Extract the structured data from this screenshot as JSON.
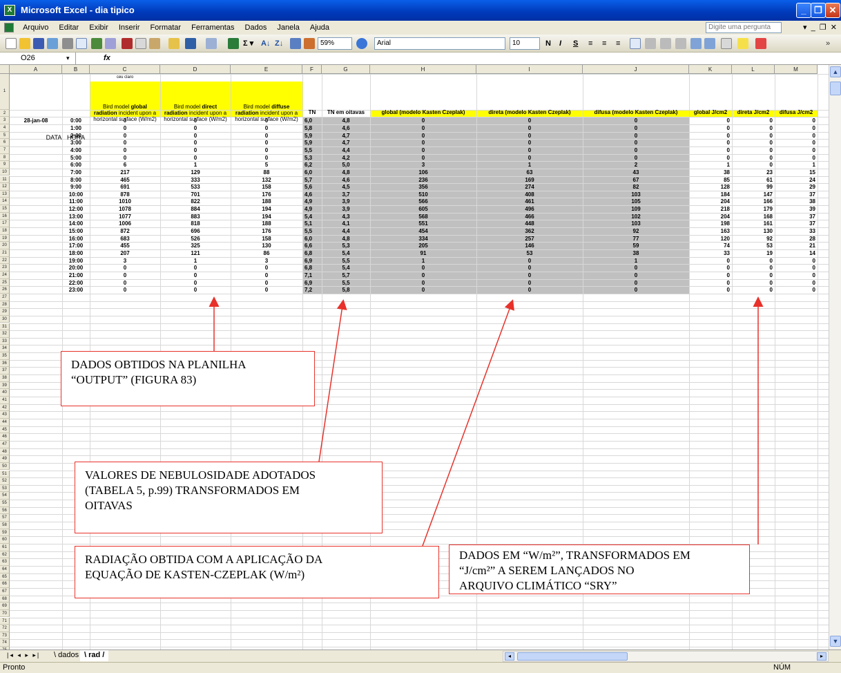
{
  "window": {
    "title": "Microsoft Excel - dia tipico",
    "app_icon": "excel-icon"
  },
  "menu": {
    "items": [
      "Arquivo",
      "Editar",
      "Exibir",
      "Inserir",
      "Formatar",
      "Ferramentas",
      "Dados",
      "Janela",
      "Ajuda"
    ],
    "ask_placeholder": "Digite uma pergunta"
  },
  "toolbar": {
    "zoom": "59%",
    "font": "Arial",
    "size": "10",
    "bold": "N",
    "italic": "I",
    "underline": "S"
  },
  "formula": {
    "cell_ref": "O26",
    "fx": "fx",
    "content": ""
  },
  "columns": [
    "A",
    "B",
    "C",
    "D",
    "E",
    "F",
    "G",
    "H",
    "I",
    "J",
    "K",
    "L",
    "M"
  ],
  "sheet": {
    "note_row1": "ceu claro",
    "headers": {
      "A": "DATA",
      "B": "HORA",
      "C": {
        "pre": "Bird model ",
        "bold": "global radiation",
        "post": " incident upon a horizontal surface (W/m2)"
      },
      "D": {
        "pre": "Bird model ",
        "bold": "direct radiation",
        "post": " incident upon a horizontal surface (W/m2)"
      },
      "E": {
        "pre": "Bird model ",
        "bold": "diffuse radiation",
        "post": " incident upon a horizontal surface (W/m2)"
      },
      "F": "TN",
      "G": "TN em oitavas",
      "H": "global (modelo Kasten Czeplak)",
      "I": "direta (modelo Kasten Czeplak)",
      "J": "difusa (modelo Kasten Czeplak)",
      "K": "global J/cm2",
      "L": "direta J/cm2",
      "M": "difusa J/cm2"
    },
    "date": "28-jan-08",
    "rows": [
      [
        "0:00",
        "0",
        "0",
        "0",
        "6,0",
        "4,8",
        "0",
        "0",
        "0",
        "0",
        "0",
        "0"
      ],
      [
        "1:00",
        "0",
        "0",
        "0",
        "5,8",
        "4,6",
        "0",
        "0",
        "0",
        "0",
        "0",
        "0"
      ],
      [
        "2:00",
        "0",
        "0",
        "0",
        "5,9",
        "4,7",
        "0",
        "0",
        "0",
        "0",
        "0",
        "0"
      ],
      [
        "3:00",
        "0",
        "0",
        "0",
        "5,9",
        "4,7",
        "0",
        "0",
        "0",
        "0",
        "0",
        "0"
      ],
      [
        "4:00",
        "0",
        "0",
        "0",
        "5,5",
        "4,4",
        "0",
        "0",
        "0",
        "0",
        "0",
        "0"
      ],
      [
        "5:00",
        "0",
        "0",
        "0",
        "5,3",
        "4,2",
        "0",
        "0",
        "0",
        "0",
        "0",
        "0"
      ],
      [
        "6:00",
        "6",
        "1",
        "5",
        "6,2",
        "5,0",
        "3",
        "1",
        "2",
        "1",
        "0",
        "1"
      ],
      [
        "7:00",
        "217",
        "129",
        "88",
        "6,0",
        "4,8",
        "106",
        "63",
        "43",
        "38",
        "23",
        "15"
      ],
      [
        "8:00",
        "465",
        "333",
        "132",
        "5,7",
        "4,6",
        "236",
        "169",
        "67",
        "85",
        "61",
        "24"
      ],
      [
        "9:00",
        "691",
        "533",
        "158",
        "5,6",
        "4,5",
        "356",
        "274",
        "82",
        "128",
        "99",
        "29"
      ],
      [
        "10:00",
        "878",
        "701",
        "176",
        "4,6",
        "3,7",
        "510",
        "408",
        "103",
        "184",
        "147",
        "37"
      ],
      [
        "11:00",
        "1010",
        "822",
        "188",
        "4,9",
        "3,9",
        "566",
        "461",
        "105",
        "204",
        "166",
        "38"
      ],
      [
        "12:00",
        "1078",
        "884",
        "194",
        "4,9",
        "3,9",
        "605",
        "496",
        "109",
        "218",
        "179",
        "39"
      ],
      [
        "13:00",
        "1077",
        "883",
        "194",
        "5,4",
        "4,3",
        "568",
        "466",
        "102",
        "204",
        "168",
        "37"
      ],
      [
        "14:00",
        "1006",
        "818",
        "188",
        "5,1",
        "4,1",
        "551",
        "448",
        "103",
        "198",
        "161",
        "37"
      ],
      [
        "15:00",
        "872",
        "696",
        "176",
        "5,5",
        "4,4",
        "454",
        "362",
        "92",
        "163",
        "130",
        "33"
      ],
      [
        "16:00",
        "683",
        "526",
        "158",
        "6,0",
        "4,8",
        "334",
        "257",
        "77",
        "120",
        "92",
        "28"
      ],
      [
        "17:00",
        "455",
        "325",
        "130",
        "6,6",
        "5,3",
        "205",
        "146",
        "59",
        "74",
        "53",
        "21"
      ],
      [
        "18:00",
        "207",
        "121",
        "86",
        "6,8",
        "5,4",
        "91",
        "53",
        "38",
        "33",
        "19",
        "14"
      ],
      [
        "19:00",
        "3",
        "1",
        "3",
        "6,9",
        "5,5",
        "1",
        "0",
        "1",
        "0",
        "0",
        "0"
      ],
      [
        "20:00",
        "0",
        "0",
        "0",
        "6,8",
        "5,4",
        "0",
        "0",
        "0",
        "0",
        "0",
        "0"
      ],
      [
        "21:00",
        "0",
        "0",
        "0",
        "7,1",
        "5,7",
        "0",
        "0",
        "0",
        "0",
        "0",
        "0"
      ],
      [
        "22:00",
        "0",
        "0",
        "0",
        "6,9",
        "5,5",
        "0",
        "0",
        "0",
        "0",
        "0",
        "0"
      ],
      [
        "23:00",
        "0",
        "0",
        "0",
        "7,2",
        "5,8",
        "0",
        "0",
        "0",
        "0",
        "0",
        "0"
      ]
    ]
  },
  "callouts": {
    "c1": [
      "DADOS OBTIDOS NA PLANILHA",
      "“OUTPUT” (FIGURA 83)"
    ],
    "c2": [
      "VALORES DE NEBULOSIDADE ADOTADOS",
      "(TABELA 5, p.99) TRANSFORMADOS EM",
      "OITAVAS"
    ],
    "c3": [
      "RADIAÇÃO OBTIDA COM A APLICAÇÃO DA",
      "EQUAÇÃO DE KASTEN-CZEPLAK (W/m²)"
    ],
    "c4": [
      "DADOS EM “W/m²”, TRANSFORMADOS EM",
      "“J/cm²” A SEREM LANÇADOS NO",
      "ARQUIVO CLIMÁTICO “SRY”"
    ]
  },
  "tabs": [
    "dados",
    "rad"
  ],
  "status": {
    "left": "Pronto",
    "right": "NÚM"
  },
  "colors": {
    "yellow": "#ffff00",
    "gray": "#c0c0c0",
    "arrow": "#e8312a"
  }
}
